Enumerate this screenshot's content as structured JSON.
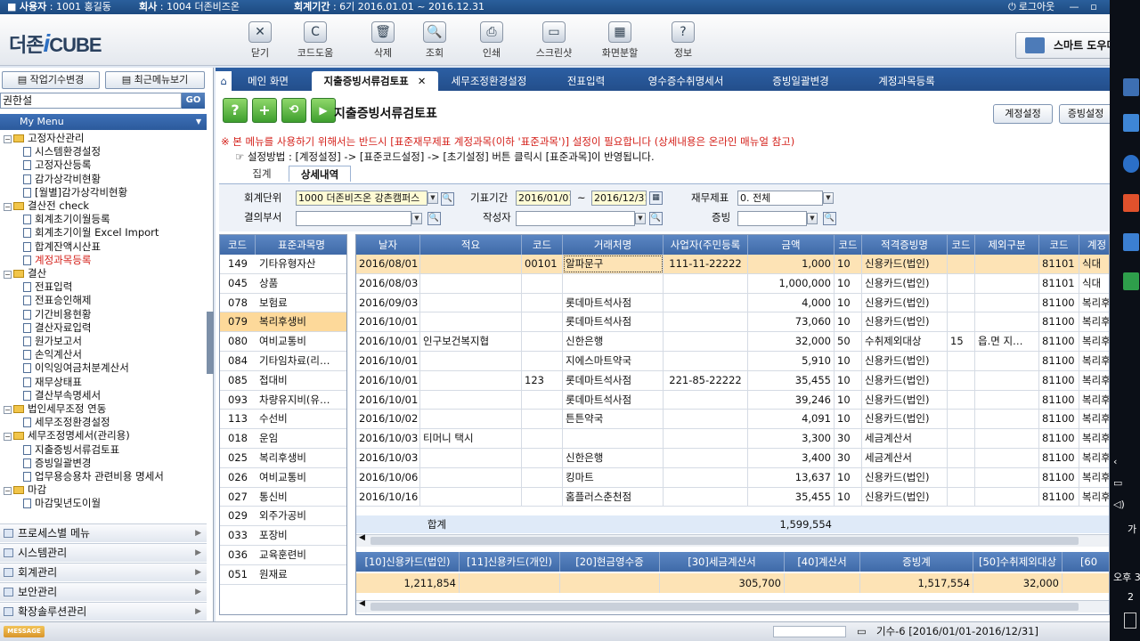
{
  "infobar": {
    "user_label": "사용자",
    "user_value": ": 1001 홍길동",
    "company_label": "회사",
    "company_value": ": 1004 더존비즈온",
    "period_label": "회계기간",
    "period_value": ": 6기 2016.01.01 ~ 2016.12.31",
    "logout": "로그아웃"
  },
  "logo": {
    "left": "더존",
    "i": "i",
    "right": "CUBE"
  },
  "toolbar": [
    {
      "label": "닫기",
      "icon": "close-icon",
      "glyph": "✕"
    },
    {
      "label": "코드도움",
      "icon": "code-help-icon",
      "glyph": "C"
    },
    {
      "label": "삭제",
      "icon": "delete-icon",
      "glyph": "🗑"
    },
    {
      "label": "조회",
      "icon": "search-icon",
      "glyph": "🔍"
    },
    {
      "label": "인쇄",
      "icon": "print-icon",
      "glyph": "⎙"
    },
    {
      "label": "스크린샷",
      "icon": "screenshot-icon",
      "glyph": "▭"
    },
    {
      "label": "화면분할",
      "icon": "split-icon",
      "glyph": "▦"
    },
    {
      "label": "정보",
      "icon": "info-icon",
      "glyph": "?"
    }
  ],
  "smart_button": "스마트 도우미",
  "left_panel": {
    "btn_work_year": "작업기수변경",
    "btn_recent_menu": "최근메뉴보기",
    "search_value": "권한설",
    "go": "GO",
    "my_menu": "My Menu",
    "tree": [
      {
        "label": "고정자산관리",
        "type": "folder",
        "indent": 0
      },
      {
        "label": "시스템환경설정",
        "type": "doc",
        "indent": 1
      },
      {
        "label": "고정자산등록",
        "type": "doc",
        "indent": 1
      },
      {
        "label": "감가상각비현황",
        "type": "doc",
        "indent": 1
      },
      {
        "label": "[월별]감가상각비현황",
        "type": "doc",
        "indent": 1
      },
      {
        "label": "결산전 check",
        "type": "folder",
        "indent": 0
      },
      {
        "label": "회계초기이월등록",
        "type": "doc",
        "indent": 1
      },
      {
        "label": "회계초기이월 Excel Import",
        "type": "doc",
        "indent": 1
      },
      {
        "label": "합계잔액시산표",
        "type": "doc",
        "indent": 1
      },
      {
        "label": "계정과목등록",
        "type": "doc",
        "indent": 1,
        "red": true
      },
      {
        "label": "결산",
        "type": "folder",
        "indent": 0
      },
      {
        "label": "전표입력",
        "type": "doc",
        "indent": 1
      },
      {
        "label": "전표승인해제",
        "type": "doc",
        "indent": 1
      },
      {
        "label": "기간비용현황",
        "type": "doc",
        "indent": 1
      },
      {
        "label": "결산자료입력",
        "type": "doc",
        "indent": 1
      },
      {
        "label": "원가보고서",
        "type": "doc",
        "indent": 1
      },
      {
        "label": "손익계산서",
        "type": "doc",
        "indent": 1
      },
      {
        "label": "이익잉여금처분계산서",
        "type": "doc",
        "indent": 1
      },
      {
        "label": "재무상태표",
        "type": "doc",
        "indent": 1
      },
      {
        "label": "결산부속명세서",
        "type": "doc",
        "indent": 1
      },
      {
        "label": "법인세무조정 연동",
        "type": "folder",
        "indent": 0
      },
      {
        "label": "세무조정환경설정",
        "type": "doc",
        "indent": 1
      },
      {
        "label": "세무조정명세서(관리용)",
        "type": "folder",
        "indent": 0
      },
      {
        "label": "지출증빙서류검토표",
        "type": "doc",
        "indent": 1
      },
      {
        "label": "증빙일괄변경",
        "type": "doc",
        "indent": 1
      },
      {
        "label": "업무용승용차 관련비용 명세서",
        "type": "doc",
        "indent": 1
      },
      {
        "label": "마감",
        "type": "folder",
        "indent": 0
      },
      {
        "label": "마감및년도이월",
        "type": "doc",
        "indent": 1
      }
    ],
    "sections": [
      "프로세스별 메뉴",
      "시스템관리",
      "회계관리",
      "보안관리",
      "확장솔루션관리"
    ]
  },
  "tabs": [
    {
      "label": "메인 화면"
    },
    {
      "label": "지출증빙서류검토표",
      "active": true
    },
    {
      "label": "세무조정환경설정"
    },
    {
      "label": "전표입력"
    },
    {
      "label": "영수증수취명세서"
    },
    {
      "label": "증빙일괄변경"
    },
    {
      "label": "계정과목등록"
    }
  ],
  "page": {
    "title": "지출증빙서류검토표",
    "btn_account_setting": "계정설정",
    "btn_evidence_setting": "증빙설정",
    "warning": "※ 본 메뉴를 사용하기 위해서는 반드시 [표준재무제표 계정과목(이하 '표준과목')] 설정이 필요합니다 (상세내용은 온라인 매뉴얼 참고)",
    "howto": "☞ 설정방법 : [계정설정] -> [표준코드설정] -> [초기설정] 버튼 클릭시 [표준과목]이 반영됩니다.",
    "subtab_total": "집계",
    "subtab_detail": "상세내역"
  },
  "filters": {
    "unit_label": "회계단위",
    "unit_value": "1000 더존비즈온 강촌캠퍼스",
    "dept_label": "결의부서",
    "dept_value": "",
    "period_label": "기표기간",
    "date_from": "2016/01/01",
    "tilde": "~",
    "date_to": "2016/12/31",
    "writer_label": "작성자",
    "writer_value": "",
    "fs_label": "재무제표",
    "fs_value": "0. 전체",
    "evid_label": "증빙",
    "evid_value": ""
  },
  "left_grid": {
    "headers": [
      "코드",
      "표준과목명"
    ],
    "rows": [
      {
        "code": "149",
        "name": "기타유형자산"
      },
      {
        "code": "045",
        "name": "상품"
      },
      {
        "code": "078",
        "name": "보험료"
      },
      {
        "code": "079",
        "name": "복리후생비",
        "selected": true
      },
      {
        "code": "080",
        "name": "여비교통비"
      },
      {
        "code": "084",
        "name": "기타임차료(리…"
      },
      {
        "code": "085",
        "name": "접대비"
      },
      {
        "code": "093",
        "name": "차량유지비(유…"
      },
      {
        "code": "113",
        "name": "수선비"
      },
      {
        "code": "018",
        "name": "운임"
      },
      {
        "code": "025",
        "name": "복리후생비"
      },
      {
        "code": "026",
        "name": "여비교통비"
      },
      {
        "code": "027",
        "name": "통신비"
      },
      {
        "code": "029",
        "name": "외주가공비"
      },
      {
        "code": "033",
        "name": "포장비"
      },
      {
        "code": "036",
        "name": "교육훈련비"
      },
      {
        "code": "051",
        "name": "원재료"
      }
    ]
  },
  "main_grid": {
    "headers": [
      "날자",
      "적요",
      "코드",
      "거래처명",
      "사업자(주민등록",
      "금액",
      "코드",
      "적격증빙명",
      "코드",
      "제외구분",
      "코드",
      "계정"
    ],
    "rows": [
      {
        "date": "2016/08/01",
        "memo": "",
        "code": "00101",
        "partner": "알파문구",
        "biz": "111-11-22222",
        "amount": "1,000",
        "ecode": "10",
        "evidence": "신용카드(법인)",
        "xcode": "",
        "exclude": "",
        "acode": "81101",
        "account": "식대",
        "selected": true
      },
      {
        "date": "2016/08/03",
        "memo": "",
        "code": "",
        "partner": "",
        "biz": "",
        "amount": "1,000,000",
        "ecode": "10",
        "evidence": "신용카드(법인)",
        "xcode": "",
        "exclude": "",
        "acode": "81101",
        "account": "식대"
      },
      {
        "date": "2016/09/03",
        "memo": "",
        "code": "",
        "partner": "롯데마트석사점",
        "biz": "",
        "amount": "4,000",
        "ecode": "10",
        "evidence": "신용카드(법인)",
        "xcode": "",
        "exclude": "",
        "acode": "81100",
        "account": "복리후"
      },
      {
        "date": "2016/10/01",
        "memo": "",
        "code": "",
        "partner": "롯데마트석사점",
        "biz": "",
        "amount": "73,060",
        "ecode": "10",
        "evidence": "신용카드(법인)",
        "xcode": "",
        "exclude": "",
        "acode": "81100",
        "account": "복리후"
      },
      {
        "date": "2016/10/01",
        "memo": "인구보건복지협",
        "code": "",
        "partner": "신한은행",
        "biz": "",
        "amount": "32,000",
        "ecode": "50",
        "evidence": "수취제외대상",
        "xcode": "15",
        "exclude": "읍.면 지…",
        "acode": "81100",
        "account": "복리후"
      },
      {
        "date": "2016/10/01",
        "memo": "",
        "code": "",
        "partner": "지에스마트약국",
        "biz": "",
        "amount": "5,910",
        "ecode": "10",
        "evidence": "신용카드(법인)",
        "xcode": "",
        "exclude": "",
        "acode": "81100",
        "account": "복리후"
      },
      {
        "date": "2016/10/01",
        "memo": "",
        "code": "123",
        "partner": "롯데마트석사점",
        "biz": "221-85-22222",
        "amount": "35,455",
        "ecode": "10",
        "evidence": "신용카드(법인)",
        "xcode": "",
        "exclude": "",
        "acode": "81100",
        "account": "복리후"
      },
      {
        "date": "2016/10/01",
        "memo": "",
        "code": "",
        "partner": "롯데마트석사점",
        "biz": "",
        "amount": "39,246",
        "ecode": "10",
        "evidence": "신용카드(법인)",
        "xcode": "",
        "exclude": "",
        "acode": "81100",
        "account": "복리후"
      },
      {
        "date": "2016/10/02",
        "memo": "",
        "code": "",
        "partner": "튼튼약국",
        "biz": "",
        "amount": "4,091",
        "ecode": "10",
        "evidence": "신용카드(법인)",
        "xcode": "",
        "exclude": "",
        "acode": "81100",
        "account": "복리후"
      },
      {
        "date": "2016/10/03",
        "memo": "티머니 택시",
        "code": "",
        "partner": "",
        "biz": "",
        "amount": "3,300",
        "ecode": "30",
        "evidence": "세금계산서",
        "xcode": "",
        "exclude": "",
        "acode": "81100",
        "account": "복리후"
      },
      {
        "date": "2016/10/03",
        "memo": "",
        "code": "",
        "partner": "신한은행",
        "biz": "",
        "amount": "3,400",
        "ecode": "30",
        "evidence": "세금계산서",
        "xcode": "",
        "exclude": "",
        "acode": "81100",
        "account": "복리후"
      },
      {
        "date": "2016/10/06",
        "memo": "",
        "code": "",
        "partner": "킹마트",
        "biz": "",
        "amount": "13,637",
        "ecode": "10",
        "evidence": "신용카드(법인)",
        "xcode": "",
        "exclude": "",
        "acode": "81100",
        "account": "복리후"
      },
      {
        "date": "2016/10/16",
        "memo": "",
        "code": "",
        "partner": "홈플러스춘천점",
        "biz": "",
        "amount": "35,455",
        "ecode": "10",
        "evidence": "신용카드(법인)",
        "xcode": "",
        "exclude": "",
        "acode": "81100",
        "account": "복리후"
      }
    ],
    "sum_label": "합계",
    "sum_amount": "1,599,554"
  },
  "bottom_grid": {
    "headers": [
      "[10]신용카드(법인)",
      "[11]신용카드(개인)",
      "[20]현금영수증",
      "[30]세금계산서",
      "[40]계산서",
      "증빙계",
      "[50]수취제외대상",
      "[60"
    ],
    "values": [
      "1,211,854",
      "",
      "",
      "305,700",
      "",
      "1,517,554",
      "32,000",
      ""
    ]
  },
  "status": {
    "msg": "MESSAGE",
    "period": "기수-6 [2016/01/01-2016/12/31]"
  },
  "taskbar": {
    "t1": "가",
    "t2": "오후 3",
    "t3": "2"
  }
}
